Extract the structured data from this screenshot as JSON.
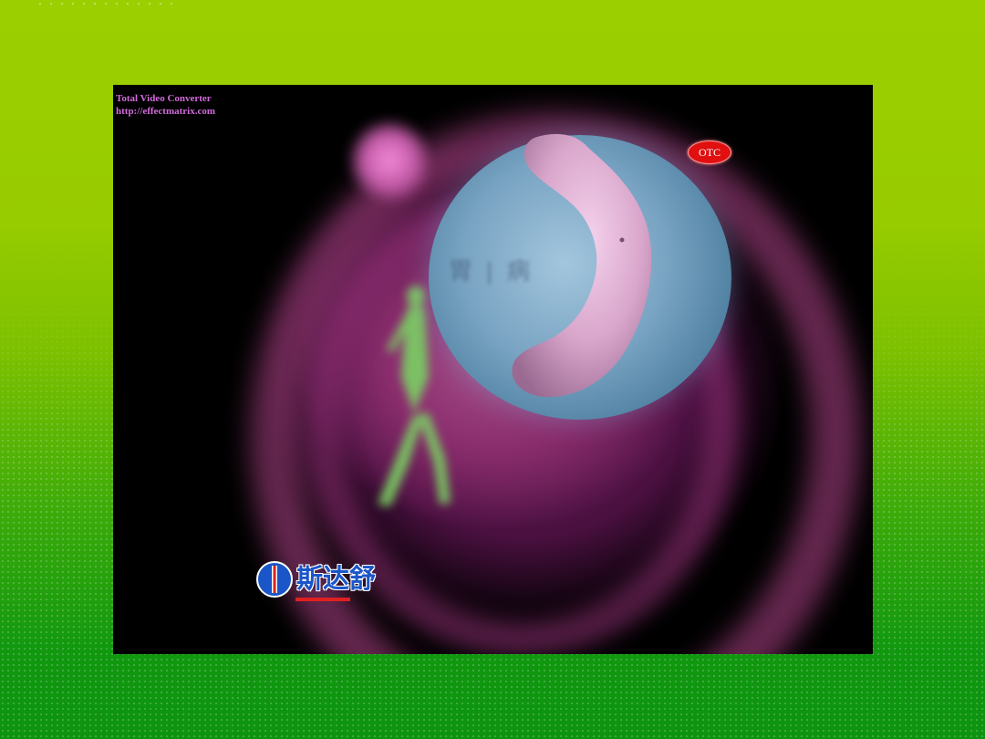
{
  "slide": {
    "background_colors": [
      "#9ccf00",
      "#0d930f"
    ]
  },
  "video": {
    "watermark_line1": "Total Video Converter",
    "watermark_line2": "http://effectmatrix.com",
    "otc_badge": "OTC",
    "ghost_text": "胃 | 病",
    "brand_name": "斯达舒",
    "brand_logo_icon": "brand-logo-icon",
    "fine_print_lines": [
      "",
      "",
      "",
      "",
      "",
      "",
      "",
      "",
      "",
      "",
      ""
    ]
  }
}
